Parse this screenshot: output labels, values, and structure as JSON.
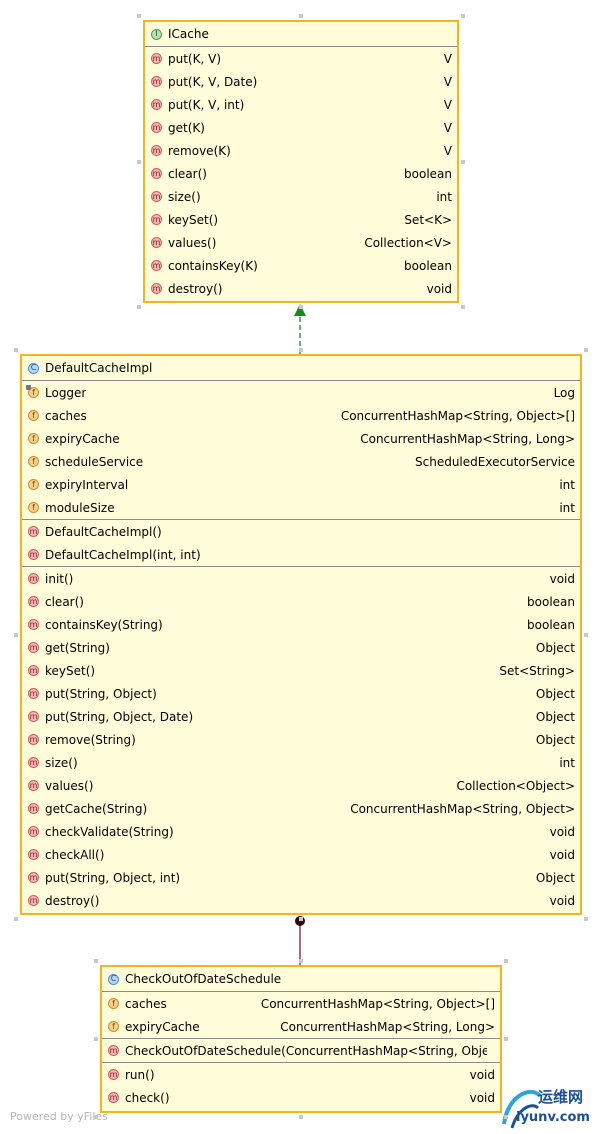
{
  "icache": {
    "icon": "I",
    "name": "ICache",
    "methods": [
      {
        "icon": "m",
        "name": "put(K, V)",
        "type": "V"
      },
      {
        "icon": "m",
        "name": "put(K, V, Date)",
        "type": "V"
      },
      {
        "icon": "m",
        "name": "put(K, V, int)",
        "type": "V"
      },
      {
        "icon": "m",
        "name": "get(K)",
        "type": "V"
      },
      {
        "icon": "m",
        "name": "remove(K)",
        "type": "V"
      },
      {
        "icon": "m",
        "name": "clear()",
        "type": "boolean"
      },
      {
        "icon": "m",
        "name": "size()",
        "type": "int"
      },
      {
        "icon": "m",
        "name": "keySet()",
        "type": "Set<K>"
      },
      {
        "icon": "m",
        "name": "values()",
        "type": "Collection<V>"
      },
      {
        "icon": "m",
        "name": "containsKey(K)",
        "type": "boolean"
      },
      {
        "icon": "m",
        "name": "destroy()",
        "type": "void"
      }
    ]
  },
  "defaultcache": {
    "icon": "C",
    "name": "DefaultCacheImpl",
    "fields": [
      {
        "icon": "f",
        "name": "Logger",
        "type": "Log"
      },
      {
        "icon": "f",
        "name": "caches",
        "type": "ConcurrentHashMap<String, Object>[]"
      },
      {
        "icon": "f",
        "name": "expiryCache",
        "type": "ConcurrentHashMap<String, Long>"
      },
      {
        "icon": "f",
        "name": "scheduleService",
        "type": "ScheduledExecutorService"
      },
      {
        "icon": "f",
        "name": "expiryInterval",
        "type": "int"
      },
      {
        "icon": "f",
        "name": "moduleSize",
        "type": "int"
      }
    ],
    "constructors": [
      {
        "icon": "m",
        "name": "DefaultCacheImpl()",
        "type": ""
      },
      {
        "icon": "m",
        "name": "DefaultCacheImpl(int, int)",
        "type": ""
      }
    ],
    "methods": [
      {
        "icon": "m",
        "name": "init()",
        "type": "void"
      },
      {
        "icon": "m",
        "name": "clear()",
        "type": "boolean"
      },
      {
        "icon": "m",
        "name": "containsKey(String)",
        "type": "boolean"
      },
      {
        "icon": "m",
        "name": "get(String)",
        "type": "Object"
      },
      {
        "icon": "m",
        "name": "keySet()",
        "type": "Set<String>"
      },
      {
        "icon": "m",
        "name": "put(String, Object)",
        "type": "Object"
      },
      {
        "icon": "m",
        "name": "put(String, Object, Date)",
        "type": "Object"
      },
      {
        "icon": "m",
        "name": "remove(String)",
        "type": "Object"
      },
      {
        "icon": "m",
        "name": "size()",
        "type": "int"
      },
      {
        "icon": "m",
        "name": "values()",
        "type": "Collection<Object>"
      },
      {
        "icon": "m",
        "name": "getCache(String)",
        "type": "ConcurrentHashMap<String, Object>"
      },
      {
        "icon": "m",
        "name": "checkValidate(String)",
        "type": "void"
      },
      {
        "icon": "m",
        "name": "checkAll()",
        "type": "void"
      },
      {
        "icon": "m",
        "name": "put(String, Object, int)",
        "type": "Object"
      },
      {
        "icon": "m",
        "name": "destroy()",
        "type": "void"
      }
    ]
  },
  "checkout": {
    "icon": "C",
    "name": "CheckOutOfDateSchedule",
    "fields": [
      {
        "icon": "f",
        "name": "caches",
        "type": "ConcurrentHashMap<String, Object>[]"
      },
      {
        "icon": "f",
        "name": "expiryCache",
        "type": "ConcurrentHashMap<String, Long>"
      }
    ],
    "constructors": [
      {
        "icon": "m",
        "name": "CheckOutOfDateSchedule(ConcurrentHashMap<String, Object>[]",
        "type": ""
      }
    ],
    "methods": [
      {
        "icon": "m",
        "name": "run()",
        "type": "void"
      },
      {
        "icon": "m",
        "name": "check()",
        "type": "void"
      }
    ]
  },
  "footer": "Powered by yFiles",
  "watermark": {
    "cn": "运维网",
    "en": "iyunv.com"
  },
  "colors": {
    "box_fill": "#fffdd9",
    "box_border": "#f5b31d",
    "realization": "#1a8a1a",
    "association": "#7a1d3a"
  }
}
